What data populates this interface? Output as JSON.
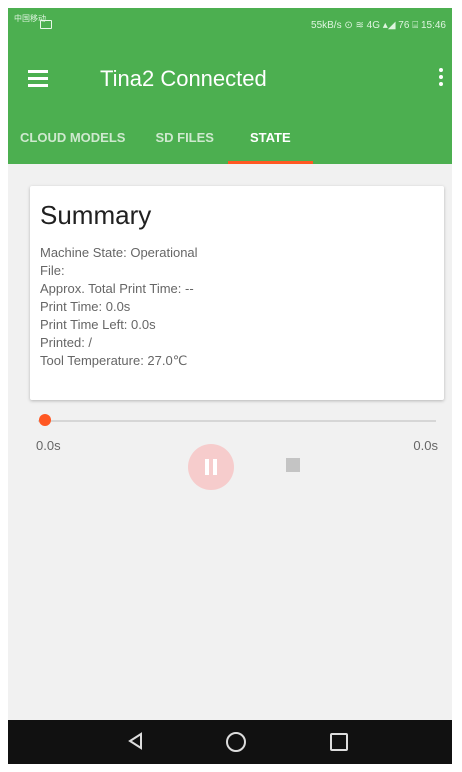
{
  "status_bar": {
    "left_text": "中国移动",
    "right_text": "55kB/s ⊙ ≋ 4G ▴◢ 76 ⌸ 15:46"
  },
  "app_bar": {
    "title": "Tina2 Connected"
  },
  "tabs": [
    {
      "label": "CLOUD MODELS",
      "active": false
    },
    {
      "label": "SD FILES",
      "active": false
    },
    {
      "label": "STATE",
      "active": true
    }
  ],
  "summary": {
    "title": "Summary",
    "lines": [
      "Machine State: Operational",
      "File:",
      "Approx. Total Print Time: --",
      "Print Time: 0.0s",
      "Print Time Left: 0.0s",
      "Printed: /",
      "Tool Temperature: 27.0℃"
    ]
  },
  "progress": {
    "value": 0,
    "elapsed": "0.0s",
    "remaining": "0.0s"
  },
  "colors": {
    "primary": "#4caf50",
    "accent": "#ff5722",
    "background": "#f1f1f1",
    "navbar": "#111111"
  }
}
